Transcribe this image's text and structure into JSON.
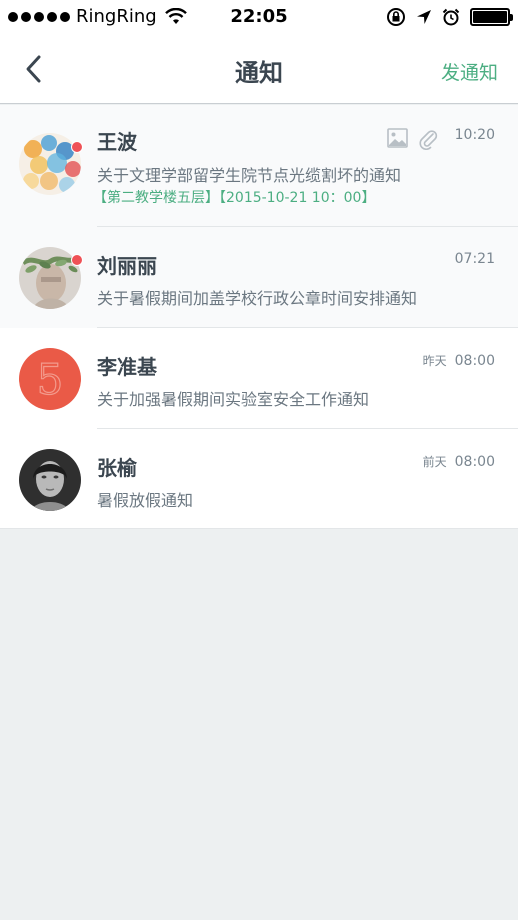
{
  "status_bar": {
    "carrier": "RingRing",
    "time": "22:05"
  },
  "nav": {
    "title": "通知",
    "action": "发通知"
  },
  "items": [
    {
      "name": "王波",
      "subject": "关于文理学部留学生院节点光缆割坏的通知",
      "meta": "【第二教学楼五层】【2015-10-21 10：00】",
      "time": "10:20",
      "day": "",
      "unread": true,
      "has_image": true,
      "has_attachment": true,
      "avatar_icon": "watercolor-circles-avatar"
    },
    {
      "name": "刘丽丽",
      "subject": "关于暑假期间加盖学校行政公章时间安排通知",
      "time": "07:21",
      "day": "",
      "unread": true,
      "avatar_icon": "woman-with-leaves-avatar"
    },
    {
      "name": "李准基",
      "subject": "关于加强暑假期间实验室安全工作通知",
      "time": "08:00",
      "day": "昨天",
      "unread": false,
      "avatar_icon": "red-number-five-avatar"
    },
    {
      "name": "张榆",
      "subject": "暑假放假通知",
      "time": "08:00",
      "day": "前天",
      "unread": false,
      "avatar_icon": "woman-portrait-avatar"
    }
  ],
  "colors": {
    "accent": "#4cae82",
    "badge": "#ef5156",
    "background": "#edf0f1"
  }
}
